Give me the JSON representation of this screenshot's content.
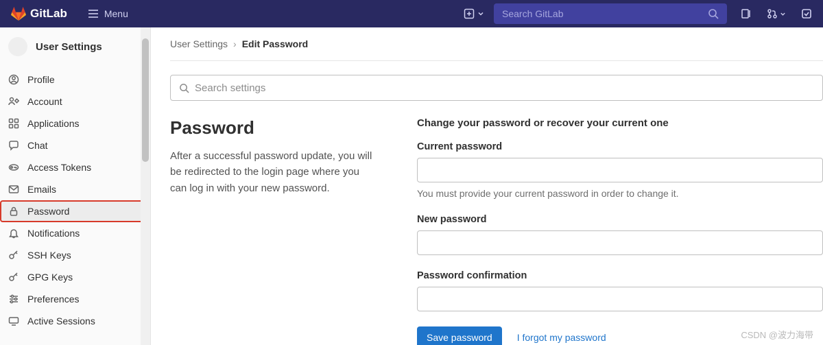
{
  "topbar": {
    "brand": "GitLab",
    "menu": "Menu",
    "search_placeholder": "Search GitLab"
  },
  "sidebar": {
    "title": "User Settings",
    "items": [
      {
        "label": "Profile",
        "icon": "profile"
      },
      {
        "label": "Account",
        "icon": "account"
      },
      {
        "label": "Applications",
        "icon": "applications"
      },
      {
        "label": "Chat",
        "icon": "chat"
      },
      {
        "label": "Access Tokens",
        "icon": "token"
      },
      {
        "label": "Emails",
        "icon": "email"
      },
      {
        "label": "Password",
        "icon": "lock",
        "active": true
      },
      {
        "label": "Notifications",
        "icon": "bell"
      },
      {
        "label": "SSH Keys",
        "icon": "key"
      },
      {
        "label": "GPG Keys",
        "icon": "key"
      },
      {
        "label": "Preferences",
        "icon": "preferences"
      },
      {
        "label": "Active Sessions",
        "icon": "sessions"
      }
    ]
  },
  "breadcrumb": {
    "parent": "User Settings",
    "current": "Edit Password"
  },
  "search_settings_placeholder": "Search settings",
  "page": {
    "heading": "Password",
    "description": "After a successful password update, you will be redirected to the login page where you can log in with your new password.",
    "section_title": "Change your password or recover your current one",
    "current_password_label": "Current password",
    "current_password_hint": "You must provide your current password in order to change it.",
    "new_password_label": "New password",
    "confirm_label": "Password confirmation",
    "save_button": "Save password",
    "forgot_link": "I forgot my password"
  },
  "watermark": "CSDN @波力海带"
}
